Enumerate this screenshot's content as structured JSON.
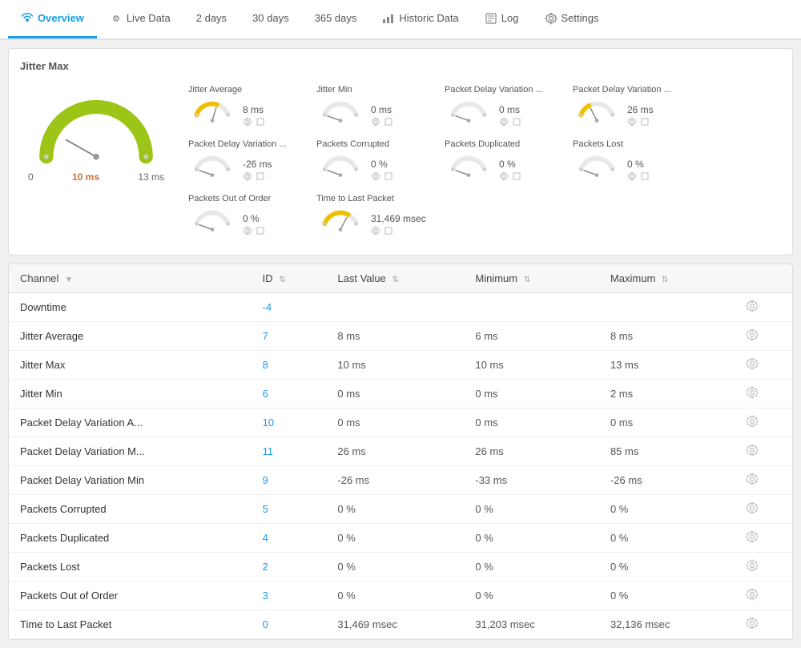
{
  "nav": {
    "items": [
      {
        "label": "Overview",
        "icon": "wifi-icon",
        "active": true
      },
      {
        "label": "Live Data",
        "icon": "live-icon",
        "active": false
      },
      {
        "label": "2 days",
        "icon": "",
        "active": false
      },
      {
        "label": "30 days",
        "icon": "",
        "active": false
      },
      {
        "label": "365 days",
        "icon": "",
        "active": false
      },
      {
        "label": "Historic Data",
        "icon": "chart-icon",
        "active": false
      },
      {
        "label": "Log",
        "icon": "log-icon",
        "active": false
      },
      {
        "label": "Settings",
        "icon": "gear-icon",
        "active": false
      }
    ]
  },
  "big_gauge": {
    "title": "Jitter Max",
    "value": "10 ms",
    "label_left": "0",
    "label_right": "13 ms"
  },
  "small_gauges": [
    {
      "label": "Jitter Average",
      "value": "8 ms",
      "pct": 0.62,
      "yellow": true
    },
    {
      "label": "Jitter Min",
      "value": "0 ms",
      "pct": 0.0,
      "yellow": false
    },
    {
      "label": "Packet Delay Variation ...",
      "value": "0 ms",
      "pct": 0.0,
      "yellow": false
    },
    {
      "label": "Packet Delay Variation ...",
      "value": "26 ms",
      "pct": 0.31,
      "yellow": true
    },
    {
      "label": "Packet Delay Variation ...",
      "value": "-26 ms",
      "pct": 0.0,
      "yellow": true
    },
    {
      "label": "Packets Corrupted",
      "value": "0 %",
      "pct": 0.0,
      "yellow": true
    },
    {
      "label": "Packets Duplicated",
      "value": "0 %",
      "pct": 0.0,
      "yellow": true
    },
    {
      "label": "Packets Lost",
      "value": "0 %",
      "pct": 0.0,
      "yellow": true
    },
    {
      "label": "Packets Out of Order",
      "value": "0 %",
      "pct": 0.0,
      "yellow": true
    },
    {
      "label": "Time to Last Packet",
      "value": "31,469 msec",
      "pct": 0.7,
      "yellow": true
    }
  ],
  "table": {
    "columns": [
      "Channel",
      "ID",
      "Last Value",
      "Minimum",
      "Maximum",
      ""
    ],
    "rows": [
      {
        "channel": "Downtime",
        "id": "-4",
        "last_value": "",
        "minimum": "",
        "maximum": ""
      },
      {
        "channel": "Jitter Average",
        "id": "7",
        "last_value": "8 ms",
        "minimum": "6 ms",
        "maximum": "8 ms"
      },
      {
        "channel": "Jitter Max",
        "id": "8",
        "last_value": "10 ms",
        "minimum": "10 ms",
        "maximum": "13 ms"
      },
      {
        "channel": "Jitter Min",
        "id": "6",
        "last_value": "0 ms",
        "minimum": "0 ms",
        "maximum": "2 ms"
      },
      {
        "channel": "Packet Delay Variation A...",
        "id": "10",
        "last_value": "0 ms",
        "minimum": "0 ms",
        "maximum": "0 ms"
      },
      {
        "channel": "Packet Delay Variation M...",
        "id": "11",
        "last_value": "26 ms",
        "minimum": "26 ms",
        "maximum": "85 ms"
      },
      {
        "channel": "Packet Delay Variation Min",
        "id": "9",
        "last_value": "-26 ms",
        "minimum": "-33 ms",
        "maximum": "-26 ms"
      },
      {
        "channel": "Packets Corrupted",
        "id": "5",
        "last_value": "0 %",
        "minimum": "0 %",
        "maximum": "0 %"
      },
      {
        "channel": "Packets Duplicated",
        "id": "4",
        "last_value": "0 %",
        "minimum": "0 %",
        "maximum": "0 %"
      },
      {
        "channel": "Packets Lost",
        "id": "2",
        "last_value": "0 %",
        "minimum": "0 %",
        "maximum": "0 %"
      },
      {
        "channel": "Packets Out of Order",
        "id": "3",
        "last_value": "0 %",
        "minimum": "0 %",
        "maximum": "0 %"
      },
      {
        "channel": "Time to Last Packet",
        "id": "0",
        "last_value": "31,469 msec",
        "minimum": "31,203 msec",
        "maximum": "32,136 msec"
      }
    ]
  }
}
